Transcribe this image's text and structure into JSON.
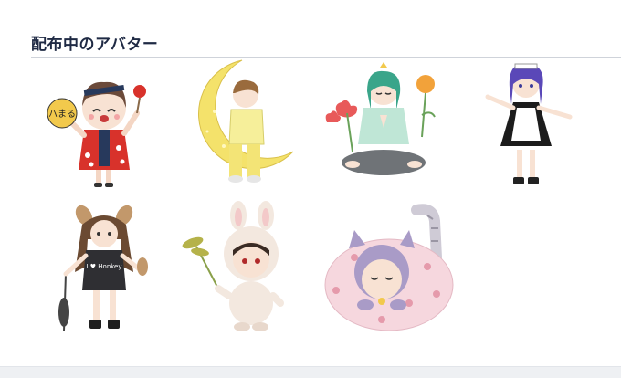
{
  "section": {
    "title": "配布中のアバター"
  },
  "avatars": [
    {
      "subject": "festival girl with uchiwa fan",
      "fan_text": "ハまる",
      "colors": {
        "hair": "#6b4a3a",
        "outfit": "#d8322b",
        "accent": "#f2c94c"
      }
    },
    {
      "subject": "boy sitting on crescent moon",
      "colors": {
        "moon": "#f4e26b",
        "outfit": "#f6ef9a",
        "hair": "#9a6b3d"
      }
    },
    {
      "subject": "meditating girl with flowers",
      "colors": {
        "hair": "#3aa58a",
        "top": "#bfe6d6",
        "pants": "#6f7377",
        "flower": "#e85a5a"
      }
    },
    {
      "subject": "maid girl with blue hair",
      "colors": {
        "hair": "#5a48b8",
        "dress": "#1c1c1c",
        "apron": "#ffffff"
      }
    },
    {
      "subject": "dog-eared girl with rice stalks",
      "shirt_text": "I ♥ Honkey",
      "colors": {
        "hair": "#6b4a32",
        "shirt": "#2f2f33"
      }
    },
    {
      "subject": "bunny costume child with rice plant",
      "colors": {
        "costume": "#f3e8df",
        "hair": "#3a2b24",
        "plant": "#b5b24a"
      }
    },
    {
      "subject": "cat-eared girl in paw-print blanket",
      "colors": {
        "blanket": "#f6d7de",
        "hair": "#a99bc7",
        "paw": "#e59aab"
      }
    }
  ]
}
